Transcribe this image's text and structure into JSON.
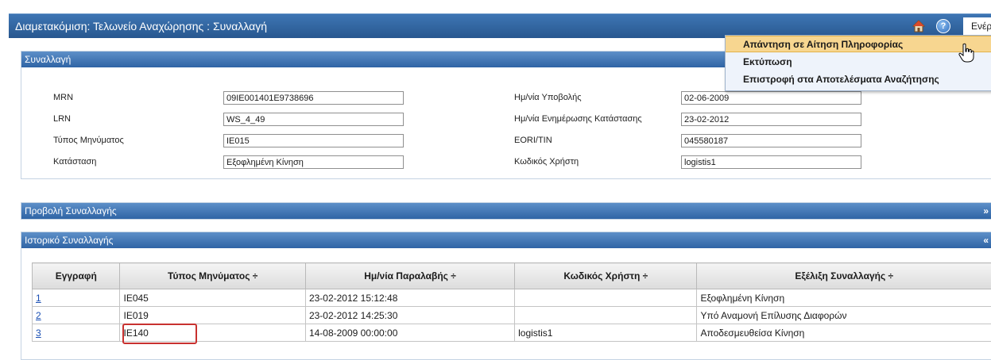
{
  "window": {
    "title": "Διαμετακόμιση: Τελωνείο Αναχώρησης : Συναλλαγή",
    "actions_label": "Ενέργειες",
    "help_glyph": "?"
  },
  "actions_menu": {
    "items": [
      {
        "label": "Απάντηση σε Αίτηση Πληροφορίας",
        "active": true
      },
      {
        "label": "Εκτύπωση",
        "active": false
      },
      {
        "label": "Επιστροφή στα Αποτελέσματα Αναζήτησης",
        "active": false
      }
    ]
  },
  "transaction_panel": {
    "title": "Συναλλαγή",
    "fields": {
      "mrn": {
        "label": "MRN",
        "value": "09IE001401E9738696"
      },
      "lrn": {
        "label": "LRN",
        "value": "WS_4_49"
      },
      "message_type": {
        "label": "Τύπος Μηνύματος",
        "value": "IE015"
      },
      "status": {
        "label": "Κατάσταση",
        "value": "Εξοφλημένη Κίνηση"
      },
      "submission_date": {
        "label": "Ημ/νία Υποβολής",
        "value": "02-06-2009"
      },
      "status_update_date": {
        "label": "Ημ/νία Ενημέρωσης Κατάστασης",
        "value": "23-02-2012"
      },
      "eori_tin": {
        "label": "EORI/TIN",
        "value": "045580187"
      },
      "user_code": {
        "label": "Κωδικός Χρήστη",
        "value": "logistis1"
      }
    }
  },
  "view_panel": {
    "title": "Προβολή Συναλλαγής",
    "toggle": "»"
  },
  "history_panel": {
    "title": "Ιστορικό Συναλλαγής",
    "toggle": "«",
    "columns": [
      "Εγγραφή",
      "Τύπος Μηνύματος ÷",
      "Ημ/νία Παραλαβής ÷",
      "Κωδικός Χρήστη ÷",
      "Εξέλιξη Συναλλαγής ÷"
    ],
    "rows": [
      {
        "no": "1",
        "type": "IE045",
        "date": "23-02-2012 15:12:48",
        "user": "",
        "progress": "Εξοφλημένη Κίνηση"
      },
      {
        "no": "2",
        "type": "IE019",
        "date": "23-02-2012 14:25:30",
        "user": "",
        "progress": "Υπό Αναμονή Επίλυσης Διαφορών"
      },
      {
        "no": "3",
        "type": "IE140",
        "date": "14-08-2009 00:00:00",
        "user": "logistis1",
        "progress": "Αποδεσμευθείσα Κίνηση"
      }
    ]
  },
  "colors": {
    "header_blue": "#2f64a5",
    "menu_highlight": "#f7d690",
    "highlight_box": "#c8312f"
  }
}
